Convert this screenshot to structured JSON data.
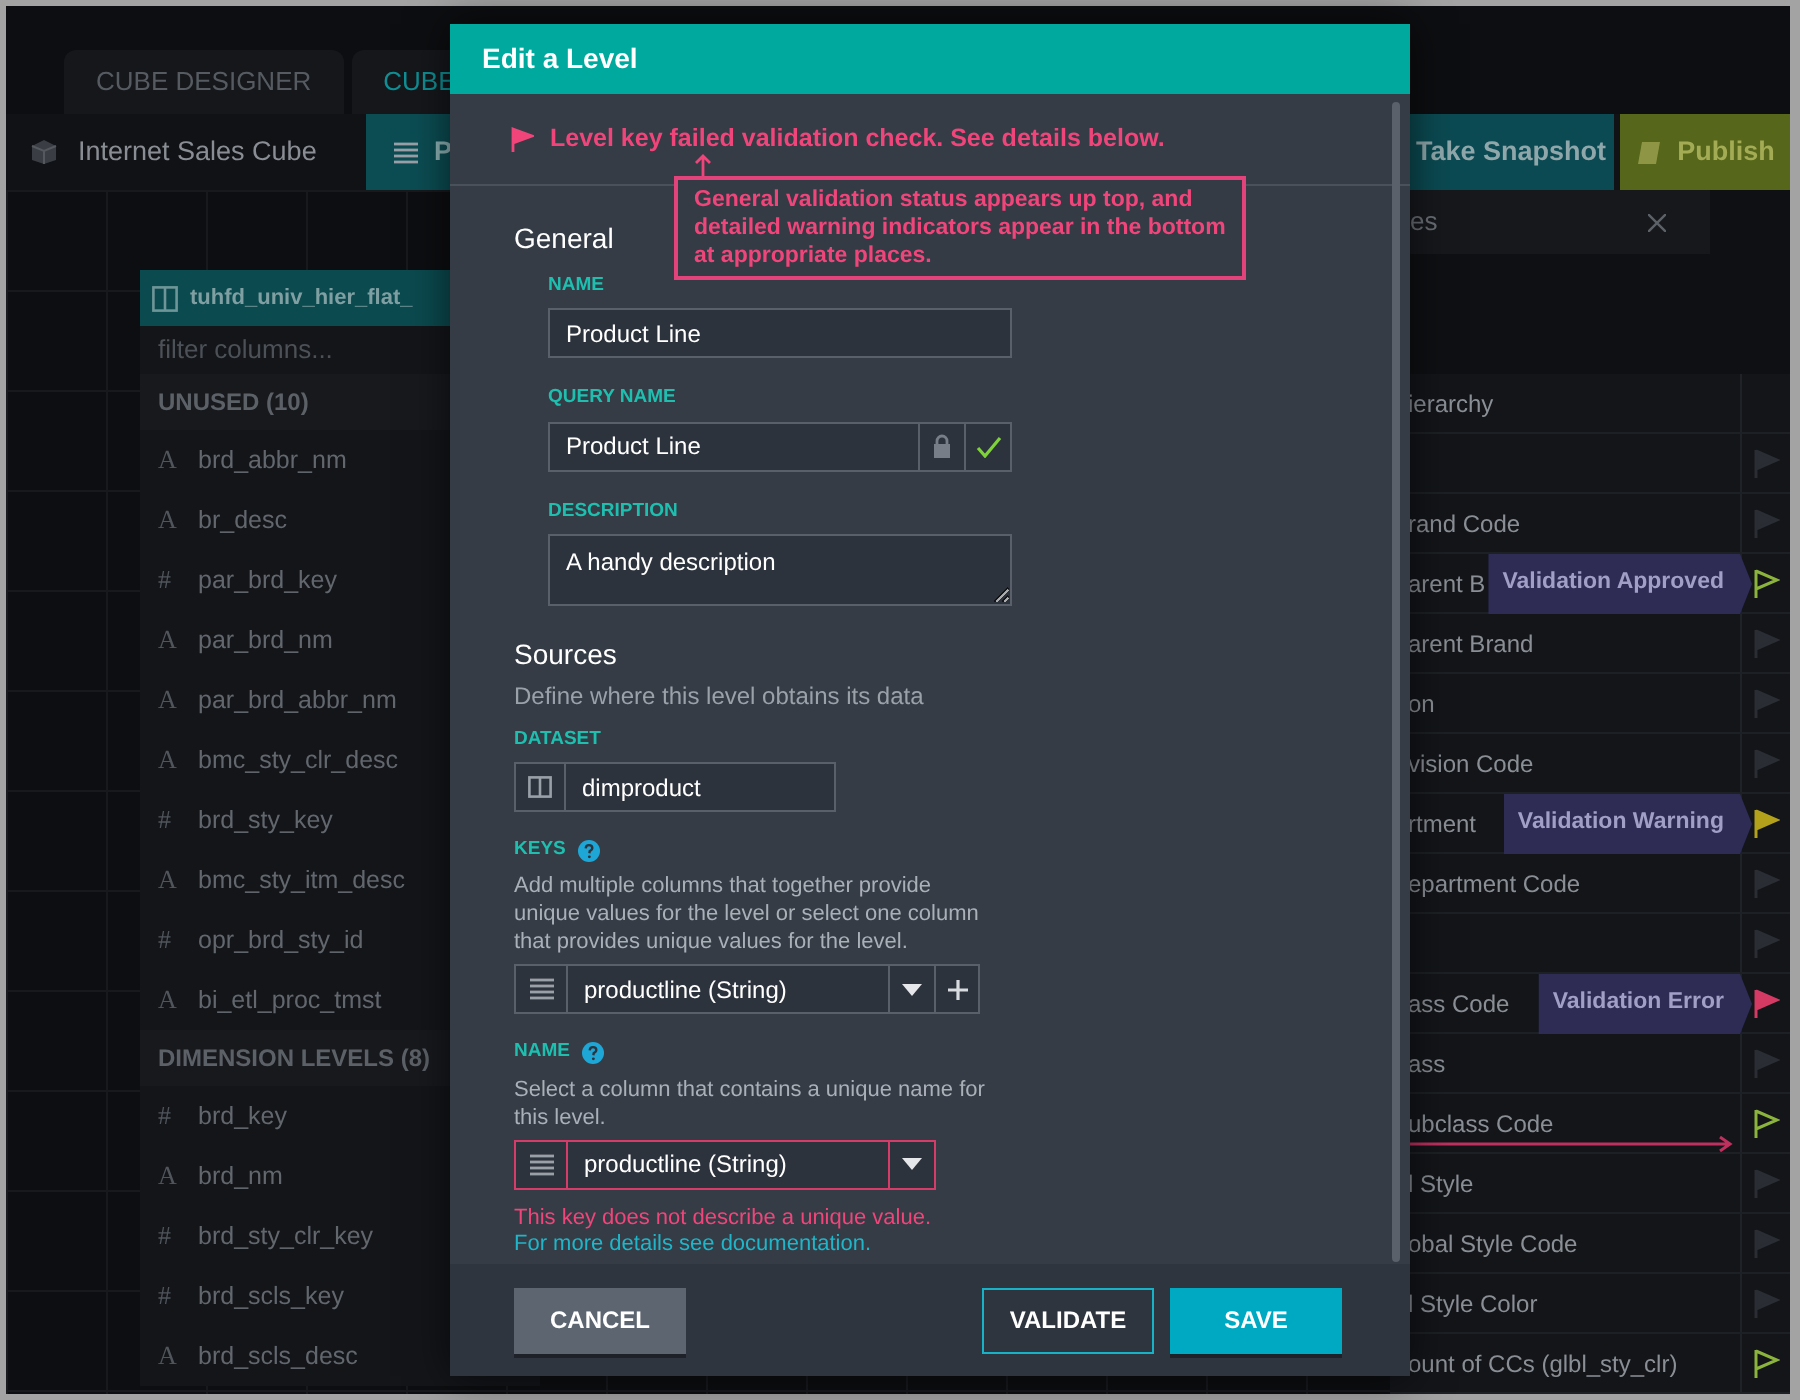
{
  "tabs": [
    {
      "label": "CUBE DESIGNER",
      "selected": false
    },
    {
      "label": "CUBE",
      "selected": true
    }
  ],
  "toolbar": {
    "cube_name": "Internet Sales Cube",
    "actions": [
      {
        "label": "P",
        "kind": "list"
      },
      {
        "label": "Take Snapshot",
        "kind": "snapshot"
      },
      {
        "label": "Publish",
        "kind": "publish"
      }
    ]
  },
  "columns_panel": {
    "title": "tuhfd_univ_hier_flat_",
    "filter_placeholder": "filter columns...",
    "sections": [
      {
        "title": "UNUSED (10)",
        "items": [
          {
            "icon": "A",
            "name": "brd_abbr_nm"
          },
          {
            "icon": "A",
            "name": "br_desc"
          },
          {
            "icon": "#",
            "name": "par_brd_key"
          },
          {
            "icon": "A",
            "name": "par_brd_nm"
          },
          {
            "icon": "A",
            "name": "par_brd_abbr_nm"
          },
          {
            "icon": "A",
            "name": "bmc_sty_clr_desc"
          },
          {
            "icon": "#",
            "name": "brd_sty_key"
          },
          {
            "icon": "A",
            "name": "bmc_sty_itm_desc"
          },
          {
            "icon": "#",
            "name": "opr_brd_sty_id"
          },
          {
            "icon": "A",
            "name": "bi_etl_proc_tmst"
          }
        ]
      },
      {
        "title": "DIMENSION LEVELS (8)",
        "items": [
          {
            "icon": "#",
            "name": "brd_key"
          },
          {
            "icon": "A",
            "name": "brd_nm"
          },
          {
            "icon": "#",
            "name": "brd_sty_clr_key"
          },
          {
            "icon": "#",
            "name": "brd_scls_key"
          },
          {
            "icon": "A",
            "name": "brd_scls_desc"
          }
        ]
      }
    ]
  },
  "levels_panel": {
    "title": "es",
    "rows": [
      {
        "label": "ierarchy",
        "kind": "plain",
        "arrow": false
      },
      {
        "kind": "flag",
        "arrow": false
      },
      {
        "label": "rand Code",
        "kind": "flag",
        "arrow": false
      },
      {
        "label": "arent B",
        "kind": "approved",
        "tooltip": "Validation Approved",
        "arrow": false
      },
      {
        "label": "arent Brand",
        "kind": "flag",
        "arrow": false
      },
      {
        "label": "on",
        "kind": "flag",
        "arrow": false
      },
      {
        "label": "vision Code",
        "kind": "flag",
        "arrow": false
      },
      {
        "label": "rtment",
        "kind": "warning",
        "tooltip": "Validation Warning",
        "arrow": false
      },
      {
        "label": "epartment Code",
        "kind": "flag",
        "arrow": false
      },
      {
        "kind": "flag",
        "arrow": false
      },
      {
        "label": "ass Code",
        "kind": "error",
        "tooltip": "Validation Error",
        "arrow": false
      },
      {
        "label": "ass",
        "kind": "flag",
        "arrow": false
      },
      {
        "label": "ubclass Code",
        "kind": "approved",
        "arrow": true
      },
      {
        "label": "l Style",
        "kind": "flag",
        "arrow": false
      },
      {
        "label": "obal Style Code",
        "kind": "flag",
        "arrow": false
      },
      {
        "label": "l Style Color",
        "kind": "flag",
        "arrow": false
      },
      {
        "label": "ount of CCs (glbl_sty_clr)",
        "kind": "approved",
        "arrow": false
      }
    ]
  },
  "modal": {
    "title": "Edit a Level",
    "alert": "Level key failed validation check. See details below.",
    "callout": "General validation status appears up top, and detailed warning indicators appear in the bottom at appropriate places.",
    "general": {
      "heading": "General",
      "name_label": "NAME",
      "name_value": "Product Line",
      "query_label": "QUERY NAME",
      "query_value": "Product Line",
      "query_locked": true,
      "query_validated": true,
      "description_label": "DESCRIPTION",
      "description_value": "A handy description"
    },
    "sources": {
      "heading": "Sources",
      "subtitle": "Define where this level obtains its data",
      "dataset_label": "DATASET",
      "dataset_value": "dimproduct",
      "keys_label": "KEYS",
      "keys_help": "Add multiple columns that together provide unique values for the level or select one column that provides unique values for the level.",
      "keys_value": "productline (String)",
      "keys_error": false,
      "name_label": "NAME",
      "name_help": "Select a column that contains a unique name for this level.",
      "name_value": "productline (String)",
      "name_error": true,
      "error_text": "This key does not describe a unique value.",
      "error_link": "For more details see documentation."
    },
    "buttons": {
      "cancel": "CANCEL",
      "validate": "VALIDATE",
      "save": "SAVE"
    }
  }
}
